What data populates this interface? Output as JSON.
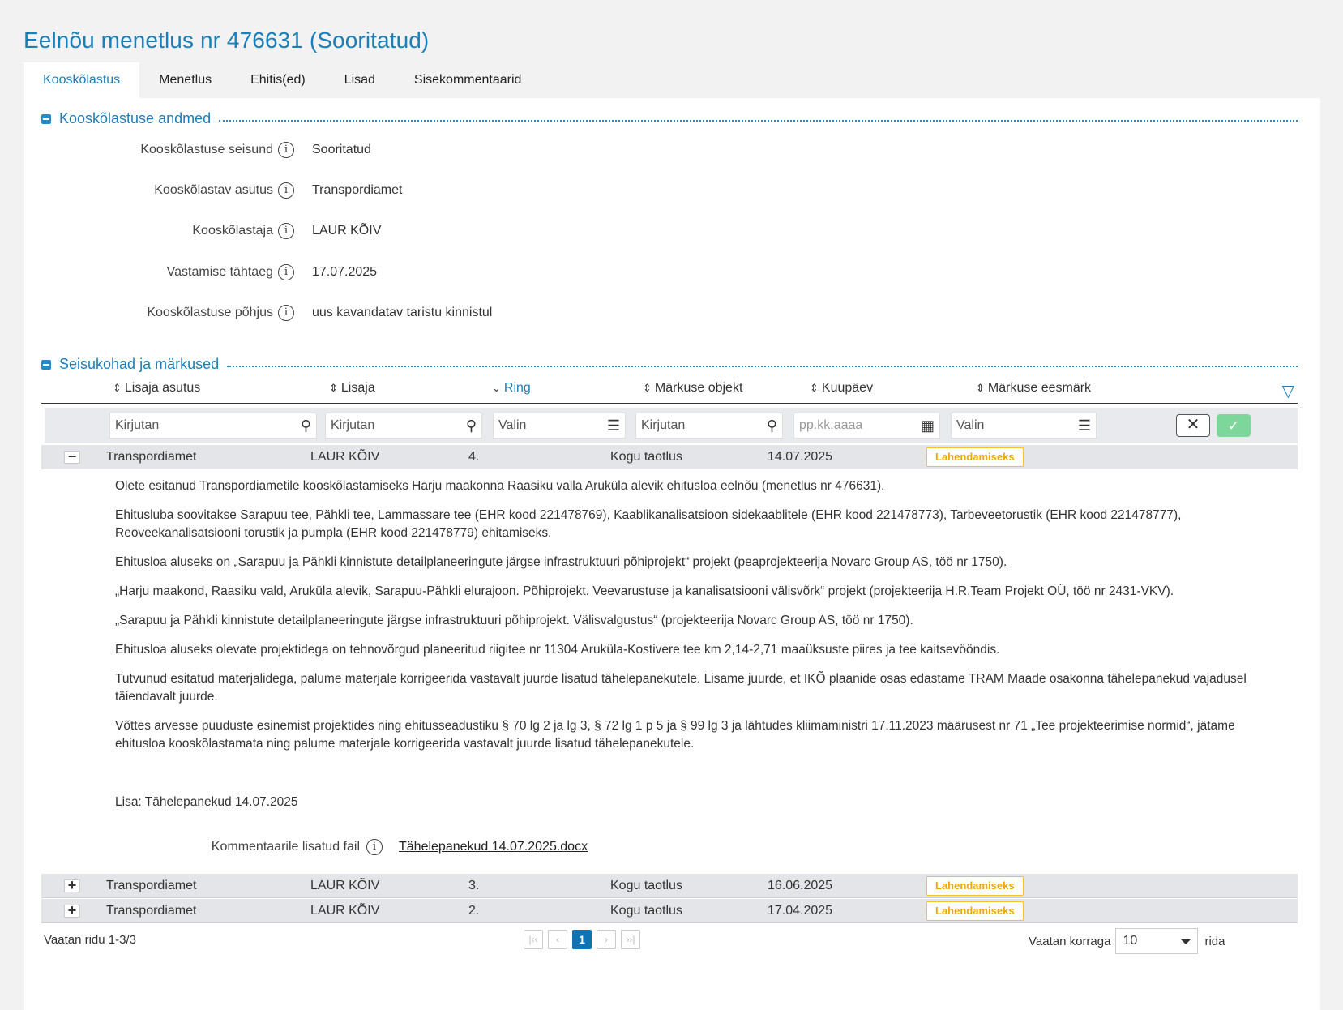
{
  "title": "Eelnõu menetlus nr 476631 (Sooritatud)",
  "tabs": [
    {
      "label": "Kooskõlastus",
      "active": true
    },
    {
      "label": "Menetlus"
    },
    {
      "label": "Ehitis(ed)"
    },
    {
      "label": "Lisad"
    },
    {
      "label": "Sisekommentaarid"
    }
  ],
  "section1": {
    "title": "Kooskõlastuse andmed",
    "fields": [
      {
        "label": "Kooskõlastuse seisund",
        "value": "Sooritatud"
      },
      {
        "label": "Kooskõlastav asutus",
        "value": "Transpordiamet"
      },
      {
        "label": "Kooskõlastaja",
        "value": "LAUR KÕIV"
      },
      {
        "label": "Vastamise tähtaeg",
        "value": "17.07.2025"
      },
      {
        "label": "Kooskõlastuse põhjus",
        "value": "uus kavandatav taristu kinnistul"
      }
    ]
  },
  "section2": {
    "title": "Seisukohad ja märkused",
    "columns": [
      "Lisaja asutus",
      "Lisaja",
      "Ring",
      "Märkuse objekt",
      "Kuupäev",
      "Märkuse eesmärk"
    ],
    "filters": {
      "f1": "Kirjutan",
      "f2": "Kirjutan",
      "f3": "Valin",
      "f4": "Kirjutan",
      "f5": "pp.kk.aaaa",
      "f6": "Valin"
    },
    "rows": [
      {
        "expander": "−",
        "asutus": "Transpordiamet",
        "lisaja": "LAUR KÕIV",
        "ring": "4.",
        "objekt": "Kogu taotlus",
        "kuupaev": "14.07.2025",
        "eesmark": "Lahendamiseks"
      },
      {
        "expander": "+",
        "asutus": "Transpordiamet",
        "lisaja": "LAUR KÕIV",
        "ring": "3.",
        "objekt": "Kogu taotlus",
        "kuupaev": "16.06.2025",
        "eesmark": "Lahendamiseks"
      },
      {
        "expander": "+",
        "asutus": "Transpordiamet",
        "lisaja": "LAUR KÕIV",
        "ring": "2.",
        "objekt": "Kogu taotlus",
        "kuupaev": "17.04.2025",
        "eesmark": "Lahendamiseks"
      }
    ],
    "detail": {
      "paragraphs": [
        "Olete esitanud Transpordiametile kooskõlastamiseks Harju maakonna Raasiku valla Aruküla alevik ehitusloa eelnõu (menetlus nr 476631).",
        "Ehitusluba soovitakse Sarapuu tee, Pähkli tee, Lammassare tee (EHR kood 221478769), Kaablikanalisatsioon sidekaablitele (EHR kood 221478773), Tarbeveetorustik (EHR kood 221478777), Reoveekanalisatsiooni torustik ja pumpla (EHR kood 221478779) ehitamiseks.",
        "Ehitusloa aluseks on „Sarapuu ja Pähkli kinnistute detailplaneeringute järgse infrastruktuuri põhiprojekt“ projekt (peaprojekteerija Novarc Group AS, töö nr 1750).",
        "„Harju maakond, Raasiku vald, Aruküla alevik, Sarapuu-Pähkli elurajoon. Põhiprojekt. Veevarustuse ja kanalisatsiooni välisvõrk“ projekt (projekteerija H.R.Team Projekt OÜ, töö nr 2431-VKV).",
        "„Sarapuu ja Pähkli kinnistute detailplaneeringute järgse infrastruktuuri põhiprojekt. Välisvalgustus“ (projekteerija Novarc Group AS, töö nr 1750).",
        "Ehitusloa aluseks olevate projektidega on tehnovõrgud planeeritud riigitee nr 11304 Aruküla-Kostivere tee km 2,14-2,71 maaüksuste piires ja tee kaitsevööndis.",
        "Tutvunud esitatud materjalidega, palume materjale korrigeerida vastavalt juurde lisatud tähelepanekutele. Lisame juurde, et IKÕ plaanide osas edastame TRAM Maade osakonna tähelepanekud vajadusel täiendavalt juurde.",
        "Võttes arvesse puuduste esinemist projektides ning ehitusseadustiku § 70 lg 2 ja lg 3, § 72 lg 1 p 5 ja § 99 lg 3 ja lähtudes kliimaministri 17.11.2023 määrusest nr 71 „Tee projekteerimise normid“, jätame ehitusloa kooskõlastamata ning palume materjale korrigeerida vastavalt juurde lisatud tähelepanekutele."
      ],
      "lisa": "Lisa: Tähelepanekud 14.07.2025",
      "attach_label": "Kommentaarile lisatud fail",
      "attach_file": "Tähelepanekud 14.07.2025.docx"
    }
  },
  "footer": {
    "rows_info": "Vaatan ridu 1-3/3",
    "pager": {
      "first": "|‹‹",
      "prev": "‹",
      "current": "1",
      "next": "›",
      "last": "››|"
    },
    "per_page_label": "Vaatan korraga",
    "per_page_value": "10",
    "per_page_suffix": "rida"
  },
  "colors": {
    "accent": "#1a7fb8",
    "badge": "#f4c22b",
    "ok": "#7dd69a"
  }
}
